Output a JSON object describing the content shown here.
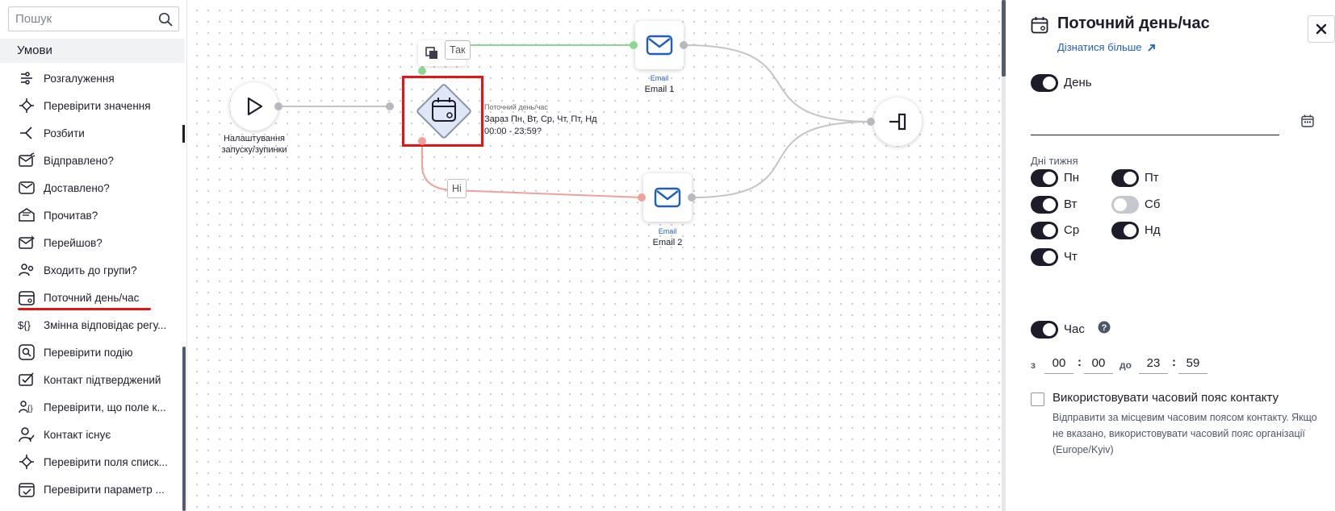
{
  "sidebar": {
    "search_placeholder": "Пошук",
    "section_title": "Умови",
    "items": [
      {
        "label": "Розгалуження",
        "icon": "branch-icon"
      },
      {
        "label": "Перевірити значення",
        "icon": "check-value-icon"
      },
      {
        "label": "Розбити",
        "icon": "split-icon"
      },
      {
        "label": "Відправлено?",
        "icon": "email-sent-icon"
      },
      {
        "label": "Доставлено?",
        "icon": "email-delivered-icon"
      },
      {
        "label": "Прочитав?",
        "icon": "email-read-icon"
      },
      {
        "label": "Перейшов?",
        "icon": "email-clicked-icon"
      },
      {
        "label": "Входить до групи?",
        "icon": "group-icon"
      },
      {
        "label": "Поточний день/час",
        "icon": "calendar-clock-icon",
        "active": true
      },
      {
        "label": "Змінна відповідає регу...",
        "icon": "variable-icon"
      },
      {
        "label": "Перевірити подію",
        "icon": "event-icon"
      },
      {
        "label": "Контакт підтверджений",
        "icon": "contact-confirmed-icon"
      },
      {
        "label": "Перевірити, що поле к...",
        "icon": "field-check-icon"
      },
      {
        "label": "Контакт існує",
        "icon": "contact-exists-icon"
      },
      {
        "label": "Перевірити поля списк...",
        "icon": "list-fields-icon"
      },
      {
        "label": "Перевірити параметр ...",
        "icon": "param-check-icon"
      }
    ]
  },
  "canvas": {
    "start_node_label": "Налаштування запуску/зупинки",
    "condition_node": {
      "type_label": "Поточний день/час",
      "days_line": "Зараз Пн, Вт, Ср, Чт, Пт, Нд",
      "time_line": "00:00 - 23:59?"
    },
    "yes_badge": "Так",
    "no_badge": "Ні",
    "email_nodes": [
      {
        "type": "Email",
        "name": "Email 1"
      },
      {
        "type": "Email",
        "name": "Email 2"
      }
    ],
    "colors": {
      "yes_edge": "#8fd694",
      "no_edge": "#f0a09a",
      "edge": "#c4c5c9",
      "selection": "#e01515"
    }
  },
  "panel": {
    "title": "Поточний день/час",
    "learn_more": "Дізнатися більше",
    "day_toggle": {
      "label": "День",
      "on": true
    },
    "weekdays_title": "Дні тижня",
    "weekdays": [
      {
        "label": "Пн",
        "on": true
      },
      {
        "label": "Вт",
        "on": true
      },
      {
        "label": "Ср",
        "on": true
      },
      {
        "label": "Чт",
        "on": true
      },
      {
        "label": "Пт",
        "on": true
      },
      {
        "label": "Сб",
        "on": false
      },
      {
        "label": "Нд",
        "on": true
      }
    ],
    "time_toggle": {
      "label": "Час",
      "on": true
    },
    "time": {
      "from_prefix": "з",
      "to_prefix": "до",
      "from_h": "00",
      "from_m": "00",
      "to_h": "23",
      "to_m": "59"
    },
    "timezone": {
      "checked": false,
      "label": "Використовувати часовий пояс контакту",
      "help": "Відправити за місцевим часовим поясом контакту. Якщо не вказано, використовувати часовий пояс організації (Europe/Kyiv)"
    }
  }
}
